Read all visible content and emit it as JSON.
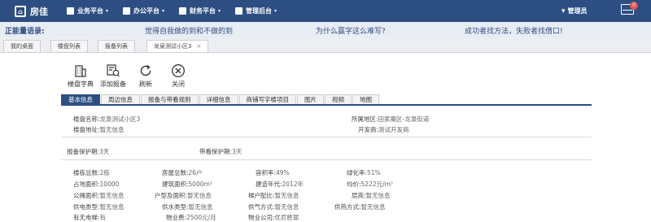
{
  "app": {
    "logo_glyph": "⌂",
    "name": "房佳"
  },
  "nav": {
    "menus": [
      {
        "label": "业务平台"
      },
      {
        "label": "办公平台"
      },
      {
        "label": "财务平台"
      },
      {
        "label": "管理后台"
      }
    ],
    "user": "管理员",
    "mail_badge": "0"
  },
  "slogan": {
    "label": "正能量语录:",
    "items": [
      "觉得自我做的到和不做的到",
      "为什么赢字这么难写?",
      "成功者找方法，失败者找借口!"
    ]
  },
  "page_tabs": [
    {
      "label": "我的桌面"
    },
    {
      "label": "楼盘列表"
    },
    {
      "label": "报备列表"
    },
    {
      "label": "龙泉测试小区3",
      "close": "×"
    }
  ],
  "toolbar": [
    {
      "label": "楼盘字典",
      "icon": "building-icon"
    },
    {
      "label": "添加报备",
      "icon": "add-report-icon"
    },
    {
      "label": "刷新",
      "icon": "refresh-icon"
    },
    {
      "label": "关闭",
      "icon": "close-icon"
    }
  ],
  "sub_tabs": [
    "基本信息",
    "周边信息",
    "报备与带看规则",
    "详细信息",
    "商铺写字楼项目",
    "图片",
    "视频",
    "地图"
  ],
  "info": {
    "name_k": "楼盘名称:",
    "name_v": "龙泉测试小区3",
    "region_k": "所属地区:",
    "region_v": "田家庵区-龙泉街道",
    "addr_k": "楼盘地址:",
    "addr_v": "暂无信息",
    "dev_k": "开发商:",
    "dev_v": "测试开发商",
    "protect_k": "报备保护期:",
    "protect_v": "3天",
    "view_k": "带看保护期:",
    "view_v": "3天"
  },
  "details": [
    [
      {
        "k": "楼栋总数:",
        "v": "2栋"
      },
      {
        "k": "房屋总数:",
        "v": "26户"
      },
      {
        "k": "容积率:",
        "v": "49%"
      },
      {
        "k": "绿化率:",
        "v": "51%"
      }
    ],
    [
      {
        "k": "占地面积:",
        "v": "10000"
      },
      {
        "k": "建筑面积:",
        "v": "5000m²"
      },
      {
        "k": "建造年代:",
        "v": "2012年"
      },
      {
        "k": "均价:",
        "v": "5222元/m²"
      }
    ],
    [
      {
        "k": "公摊面积:",
        "v": "暂无信息"
      },
      {
        "k": "户型及面积:",
        "v": "暂无信息"
      },
      {
        "k": "梯户配比:",
        "v": "暂无信息"
      },
      {
        "k": "层高:",
        "v": "暂无信息"
      }
    ],
    [
      {
        "k": "供电类型:",
        "v": "暂无信息"
      },
      {
        "k": "供水类型:",
        "v": "暂无信息"
      },
      {
        "k": "供气方式:",
        "v": "暂无信息"
      },
      {
        "k": "供热方式:",
        "v": "暂无信息"
      }
    ],
    [
      {
        "k": "有无电梯:",
        "v": "有"
      },
      {
        "k": "物业费:",
        "v": "2500元/月"
      },
      {
        "k": "物业公司:",
        "v": "优尼胜耶"
      },
      {
        "k": "",
        "v": ""
      }
    ]
  ],
  "colors": {
    "primary": "#2d4e82",
    "slogan_bg": "#e8ecf3"
  }
}
